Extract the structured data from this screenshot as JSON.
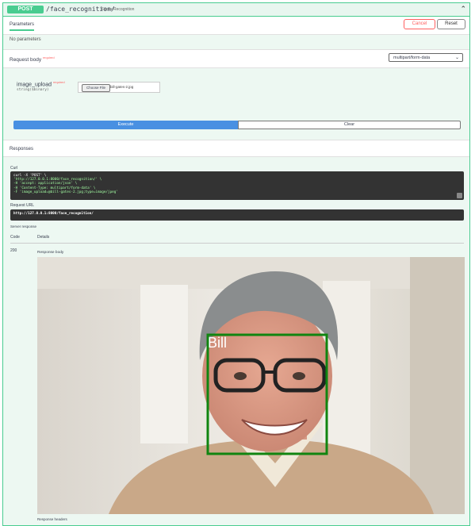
{
  "operation": {
    "method": "POST",
    "path": "/face_recognition/",
    "summary": "Faces Recognition"
  },
  "parameters": {
    "tab_label": "Parameters",
    "cancel_label": "Cancel",
    "reset_label": "Reset",
    "empty_text": "No parameters"
  },
  "request_body": {
    "label": "Request body",
    "required_text": "required",
    "content_type": "multipart/form-data",
    "field": {
      "name": "image_upload",
      "required_text": "required",
      "type": "string($binary)",
      "choose_label": "Choose File",
      "file_name": "bill-gates-2.jpg"
    }
  },
  "actions": {
    "execute_label": "Execute",
    "clear_label": "Clear"
  },
  "responses": {
    "header": "Responses",
    "curl_label": "Curl",
    "curl_lines": [
      "curl -X 'POST' \\",
      "  'http://127.0.0.1:8000/face_recognition/' \\",
      "  -H 'accept: application/json' \\",
      "  -H 'Content-Type: multipart/form-data' \\",
      "  -F 'image_upload=@bill-gates-2.jpg;type=image/jpeg'"
    ],
    "request_url_label": "Request URL",
    "request_url": "http://127.0.0.1:8000/face_recognition/",
    "server_response_label": "Server response",
    "code_header": "Code",
    "details_header": "Details",
    "status_code": "200",
    "response_body_label": "Response body",
    "face_label": "Bill",
    "response_headers_label": "Response headers"
  },
  "colors": {
    "post_green": "#49cc90",
    "execute_blue": "#4990e2",
    "cancel_red": "#ff6060",
    "box_green": "#108510"
  }
}
